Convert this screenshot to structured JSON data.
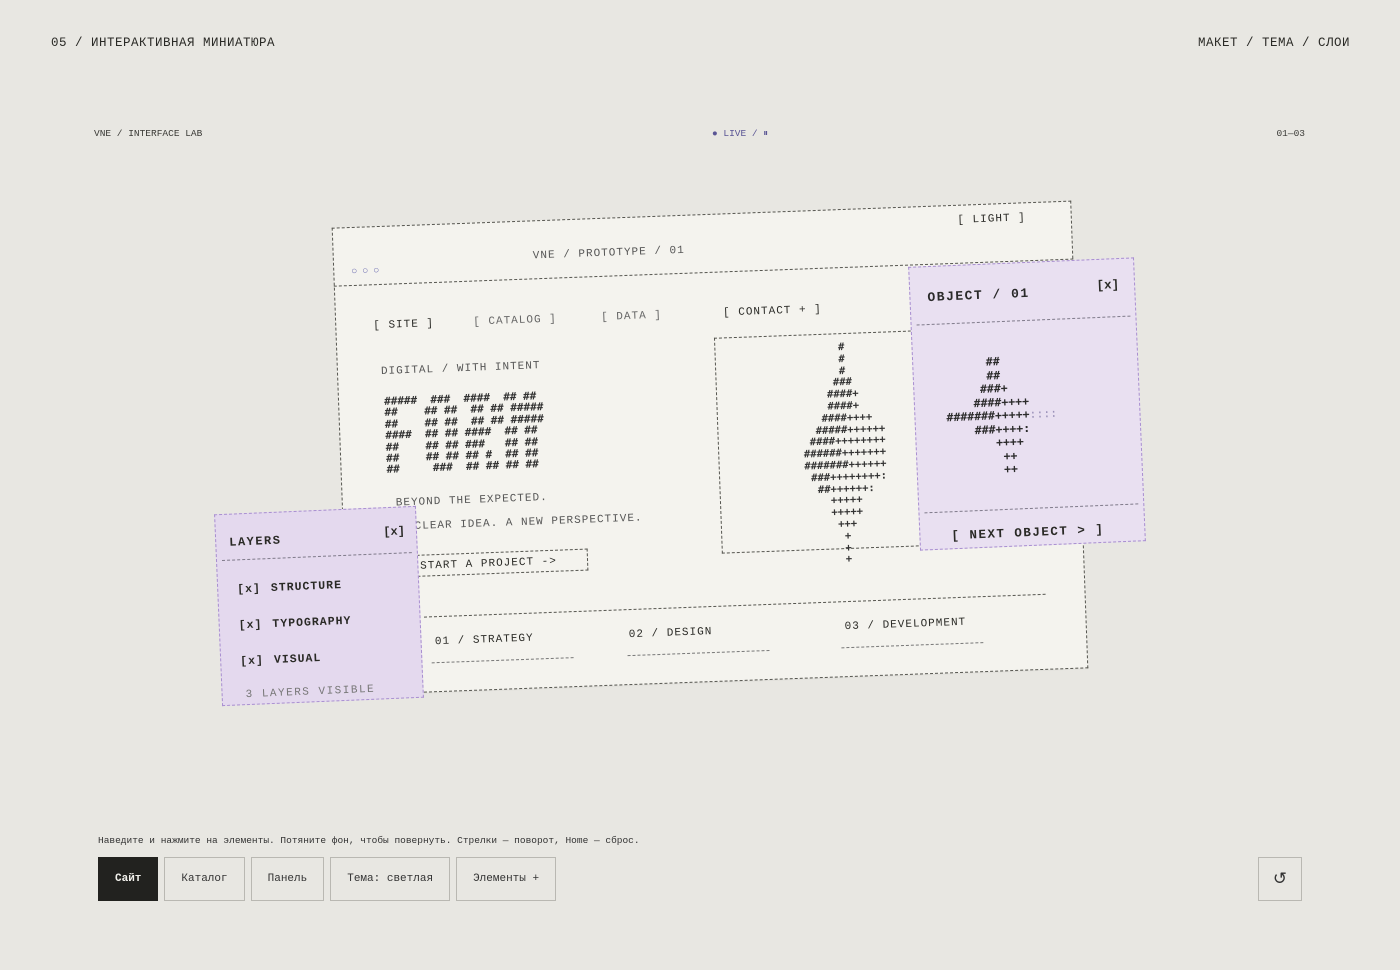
{
  "header": {
    "left": "05 / ИНТЕРАКТИВНАЯ МИНИАТЮРА",
    "right": "МАКЕТ / ТЕМА / СЛОИ"
  },
  "meta": {
    "brand": "VNE / INTERFACE LAB",
    "status": "● LIVE / ⏸",
    "counter": "01—03"
  },
  "prototype": {
    "dots": "○○○",
    "title": "VNE / PROTOTYPE / 01",
    "theme_toggle": "[ LIGHT ]",
    "nav": [
      "[ SITE ]",
      "[ CATALOG ]",
      "[ DATA ]",
      "[ CONTACT + ]"
    ],
    "tagline": "DIGITAL / WITH INTENT",
    "ascii_logo": "#####  ###  ####  ## ##\n##    ## ##  ## ## #####\n##    ## ##  ## ## #####\n####  ## ## ####  ## ##\n##    ## ## ###   ## ##\n##    ## ## ## #  ## ##\n##     ###  ## ## ## ##",
    "line1": "BEYOND THE EXPECTED.",
    "line2": "CLEAR IDEA. A NEW PERSPECTIVE.",
    "cta": "START A PROJECT ->",
    "arrow_art": "        #\n        #\n        #\n       ###\n      ####+\n      ####+\n     ####++++\n    #####++++++\n   ####++++++++\n  ######+++++++\n  #######++++++\n   ###++++++++:\n    ##++++++:\n      +++++\n      +++++\n       +++\n        +\n        +\n        +",
    "services": [
      "01 / STRATEGY",
      "02 / DESIGN",
      "03 / DEVELOPMENT"
    ]
  },
  "object_panel": {
    "title": "OBJECT / 01",
    "close": "[x]",
    "art_lines": [
      "      ##",
      "      ##",
      "     ###+",
      "    ####++++",
      "#######+++++",
      "    ###++++:",
      "       ++++",
      "        ++",
      "        ++"
    ],
    "art_tail": "::::",
    "next": "[ NEXT OBJECT > ]"
  },
  "layers_panel": {
    "title": "LAYERS",
    "close": "[x]",
    "items": [
      {
        "check": "[x]",
        "label": "STRUCTURE"
      },
      {
        "check": "[x]",
        "label": "TYPOGRAPHY"
      },
      {
        "check": "[x]",
        "label": "VISUAL"
      }
    ],
    "count": "3 LAYERS VISIBLE"
  },
  "controls": {
    "hint": "Наведите и нажмите на элементы. Потяните фон, чтобы повернуть. Стрелки — поворот, Home — сброс.",
    "buttons": [
      "Сайт",
      "Каталог",
      "Панель",
      "Тема: светлая",
      "Элементы +"
    ],
    "active_index": 0,
    "reset_icon": "↺"
  },
  "colors": {
    "background": "#e8e7e2",
    "card": "#f4f3ee",
    "panel_purple": "#e4d9ee",
    "dash_purple": "#a88ed0",
    "active_button": "#22221f"
  }
}
